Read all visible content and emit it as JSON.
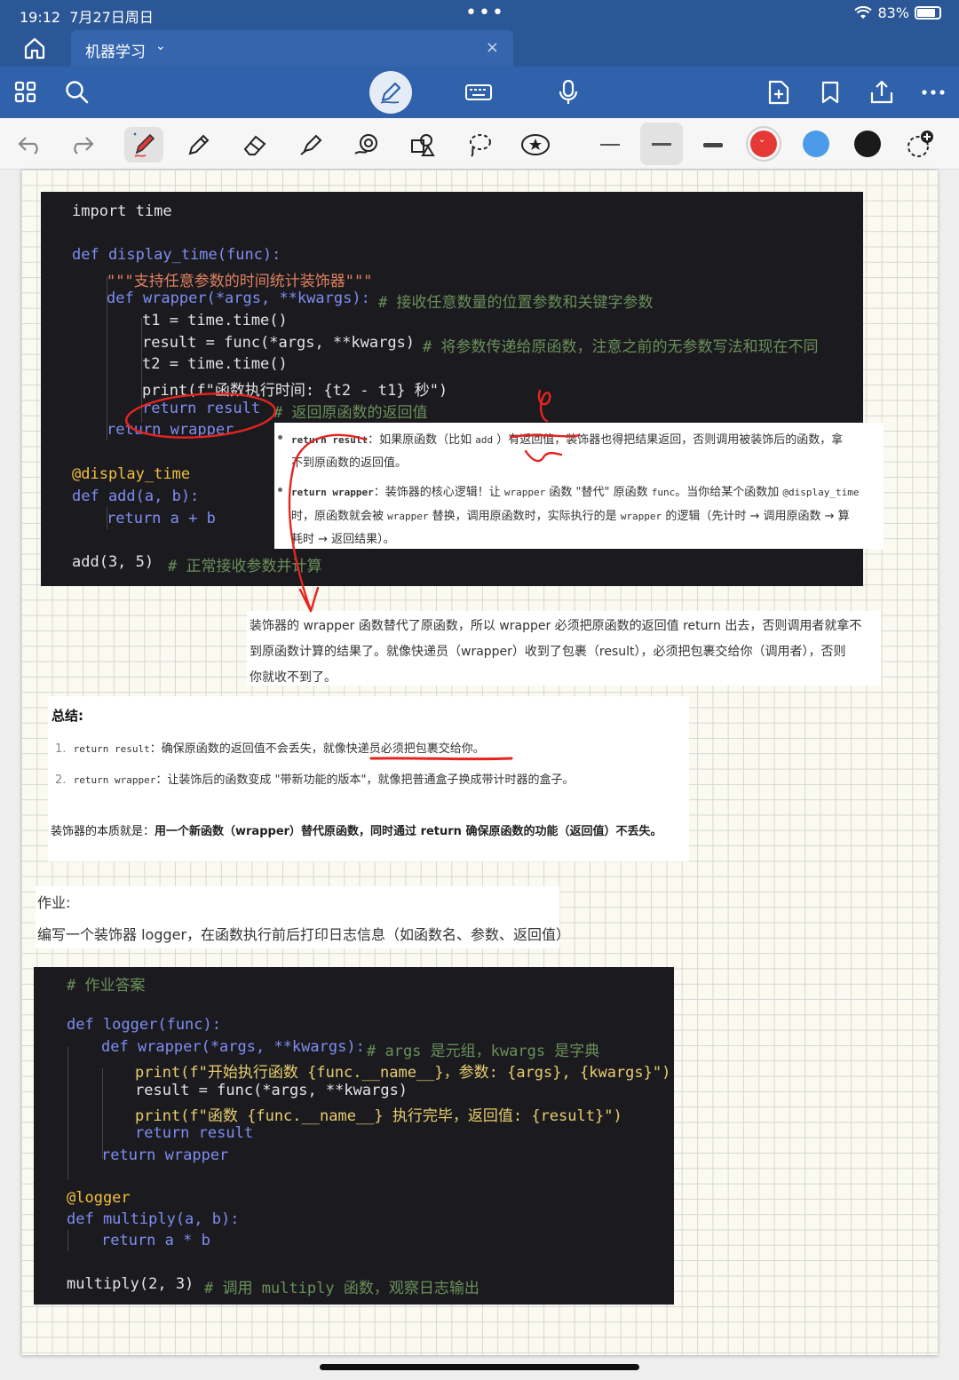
{
  "status": {
    "time": "19:12",
    "date": "7月27日周日",
    "battery": "83%"
  },
  "tab": {
    "title": "机器学习",
    "chevron": "⌄",
    "close": "×"
  },
  "colors": {
    "accent": "#2f62ab",
    "ink": "#e52420",
    "pen_red": "#e53935",
    "pen_blue": "#4a9be8",
    "pen_black": "#1a1a1a"
  },
  "code1": {
    "l1": "import time",
    "l2": "def display_time(func):",
    "l3": "\"\"\"支持任意参数的时间统计装饰器\"\"\"",
    "l4": "def wrapper(*args, **kwargs):",
    "l4c": "# 接收任意数量的位置参数和关键字参数",
    "l5": "t1 = time.time()",
    "l6": "result = func(*args, **kwargs)",
    "l6c": "# 将参数传递给原函数，注意之前的无参数写法和现在不同",
    "l7": "t2 = time.time()",
    "l8": "print(f\"函数执行时间: {t2 - t1} 秒\")",
    "l9": "return result",
    "l9c": "# 返回原函数的返回值",
    "l10": "return wrapper",
    "l11": "@display_time",
    "l12": "def add(a, b):",
    "l13": "return a + b",
    "l14": "add(3, 5)",
    "l14c": "# 正常接收参数并计算"
  },
  "note1": {
    "b1_code": "return result",
    "b1_a": "：如果原函数（比如",
    "b1_add": "add",
    "b1_b": "）有返回值，装饰器也得把结果返回，否则调用被装饰后的函数，拿",
    "b1_c": "不到原函数的返回值。",
    "b2_code": "return wrapper",
    "b2_a": "：装饰器的核心逻辑！让",
    "b2_wrapper": "wrapper",
    "b2_b": "函数 \"替代\" 原函数",
    "b2_func": "func",
    "b2_c": "。当你给某个函数加",
    "b2_deco": "@display_time",
    "b2_d": "时，原函数就会被",
    "b2_wrapper2": "wrapper",
    "b2_e": "替换，调用原函数时，实际执行的是",
    "b2_wrapper3": "wrapper",
    "b2_f": "的逻辑（先计时 → 调用原函数 → 算",
    "b2_g": "耗时 → 返回结果）。"
  },
  "note2": {
    "l1": "装饰器的 wrapper 函数替代了原函数，所以 wrapper 必须把原函数的返回值 return 出去，否则调用者就拿不",
    "l2": "到原函数计算的结果了。就像快递员（wrapper）收到了包裹（result），必须把包裹交给你（调用者），否则",
    "l3": "你就收不到了。"
  },
  "summary": {
    "title": "总结:",
    "i1_num": "1.",
    "i1_code": "return result",
    "i1_text": "：确保原函数的返回值不会丢失，就像快递员必须把包裹交给你。",
    "i2_num": "2.",
    "i2_code": "return wrapper",
    "i2_text": "：让装饰后的函数变成 \"带新功能的版本\"，就像把普通盒子换成带计时器的盒子。",
    "essence_a": "装饰器的本质就是：",
    "essence_b": "用一个新函数（wrapper）替代原函数，同时通过 return 确保原函数的功能（返回值）不丢",
    "essence_c": "失。"
  },
  "homework": {
    "title": "作业:",
    "text": "编写一个装饰器 logger，在函数执行前后打印日志信息（如函数名、参数、返回值）"
  },
  "code2": {
    "l1": "# 作业答案",
    "l2": "def logger(func):",
    "l3": "def wrapper(*args, **kwargs):",
    "l3c": "# args 是元组，kwargs 是字典",
    "l4": "print(f\"开始执行函数 {func.__name__}，参数: {args}, {kwargs}\")",
    "l5": "result = func(*args, **kwargs)",
    "l6": "print(f\"函数 {func.__name__} 执行完毕，返回值: {result}\")",
    "l7": "return result",
    "l8": "return wrapper",
    "l9": "@logger",
    "l10": "def multiply(a, b):",
    "l11": "return a * b",
    "l12": "multiply(2, 3)",
    "l12c": "# 调用 multiply 函数，观察日志输出"
  }
}
